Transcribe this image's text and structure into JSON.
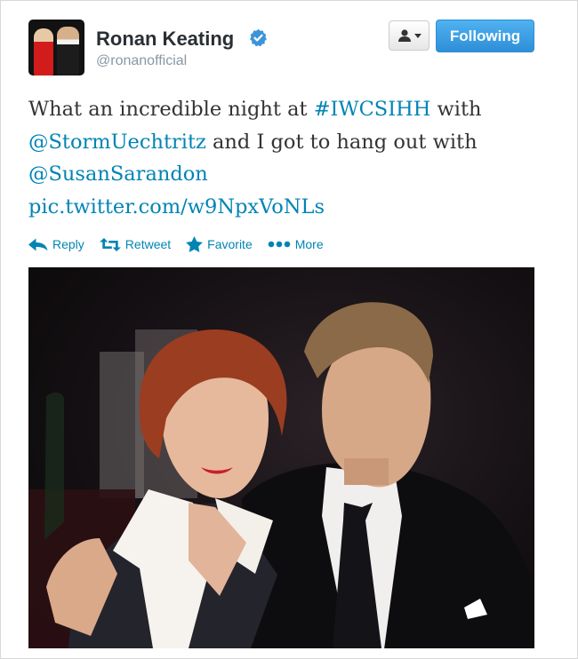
{
  "profile": {
    "display_name": "Ronan Keating",
    "handle": "@ronanofficial",
    "verified_icon": "verified-badge-icon",
    "avatar_icon": "profile-avatar-photo"
  },
  "buttons": {
    "user_dropdown_icon": "user-icon",
    "following_label": "Following"
  },
  "tweet": {
    "text_1": "What an incredible night at ",
    "hashtag": "#IWCSIHH",
    "text_2": " with",
    "mention_1": "@StormUechtritz",
    "text_3": " and I got to hang out with",
    "mention_2": "@SusanSarandon",
    "pic_link": "pic.twitter.com/w9NpxVoNLs"
  },
  "actions": {
    "reply": "Reply",
    "retweet": "Retweet",
    "favorite": "Favorite",
    "more": "More"
  },
  "colors": {
    "link": "#0084b4",
    "follow_button": "#2e8fd8",
    "verified": "#3b94d9"
  }
}
